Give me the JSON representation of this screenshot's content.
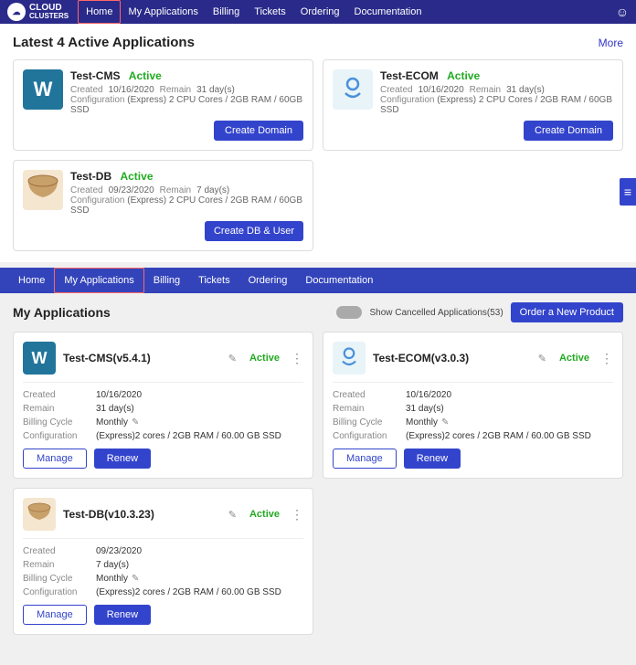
{
  "topNav": {
    "logo": "CLOUD\nCLUSTERS",
    "links": [
      {
        "label": "Home",
        "active": true
      },
      {
        "label": "My Applications",
        "active": false
      },
      {
        "label": "Billing",
        "active": false
      },
      {
        "label": "Tickets",
        "active": false
      },
      {
        "label": "Ordering",
        "active": false
      },
      {
        "label": "Documentation",
        "active": false
      }
    ]
  },
  "latestSection": {
    "title": "Latest 4 Active Applications",
    "moreLabel": "More"
  },
  "topApps": [
    {
      "name": "Test-CMS",
      "status": "Active",
      "created_label": "Created",
      "created": "10/16/2020",
      "remain_label": "Remain",
      "remain": "31 day(s)",
      "config_label": "Configuration",
      "config": "(Express) 2 CPU Cores / 2GB RAM / 60GB SSD",
      "button": "Create Domain",
      "icon_type": "wp"
    },
    {
      "name": "Test-ECOM",
      "status": "Active",
      "created_label": "Created",
      "created": "10/16/2020",
      "remain_label": "Remain",
      "remain": "31 day(s)",
      "config_label": "Configuration",
      "config": "(Express) 2 CPU Cores / 2GB RAM / 60GB SSD",
      "button": "Create Domain",
      "icon_type": "ecom"
    }
  ],
  "topAppsDb": [
    {
      "name": "Test-DB",
      "status": "Active",
      "created_label": "Created",
      "created": "09/23/2020",
      "remain_label": "Remain",
      "remain": "7 day(s)",
      "config_label": "Configuration",
      "config": "(Express) 2 CPU Cores / 2GB RAM / 60GB SSD",
      "button": "Create DB & User",
      "icon_type": "db"
    }
  ],
  "secondNav": {
    "links": [
      {
        "label": "Home",
        "active": false
      },
      {
        "label": "My Applications",
        "active": true
      },
      {
        "label": "Billing",
        "active": false
      },
      {
        "label": "Tickets",
        "active": false
      },
      {
        "label": "Ordering",
        "active": false
      },
      {
        "label": "Documentation",
        "active": false
      }
    ]
  },
  "myApps": {
    "title": "My Applications",
    "toggleLabel": "Show Cancelled Applications(53)",
    "orderButton": "Order a New Product",
    "cards": [
      {
        "name": "Test-CMS(v5.4.1)",
        "status": "Active",
        "created_label": "Created",
        "created": "10/16/2020",
        "remain_label": "Remain",
        "remain": "31 day(s)",
        "billing_label": "Billing Cycle",
        "billing": "Monthly",
        "config_label": "Configuration",
        "config": "(Express)2 cores / 2GB RAM / 60.00 GB SSD",
        "manage": "Manage",
        "renew": "Renew",
        "icon_type": "wp"
      },
      {
        "name": "Test-ECOM(v3.0.3)",
        "status": "Active",
        "created_label": "Created",
        "created": "10/16/2020",
        "remain_label": "Remain",
        "remain": "31 day(s)",
        "billing_label": "Billing Cycle",
        "billing": "Monthly",
        "config_label": "Configuration",
        "config": "(Express)2 cores / 2GB RAM / 60.00 GB SSD",
        "manage": "Manage",
        "renew": "Renew",
        "icon_type": "ecom"
      },
      {
        "name": "Test-DB(v10.3.23)",
        "status": "Active",
        "created_label": "Created",
        "created": "09/23/2020",
        "remain_label": "Remain",
        "remain": "7 day(s)",
        "billing_label": "Billing Cycle",
        "billing": "Monthly",
        "config_label": "Configuration",
        "config": "(Express)2 cores / 2GB RAM / 60.00 GB SSD",
        "manage": "Manage",
        "renew": "Renew",
        "icon_type": "db"
      }
    ]
  }
}
